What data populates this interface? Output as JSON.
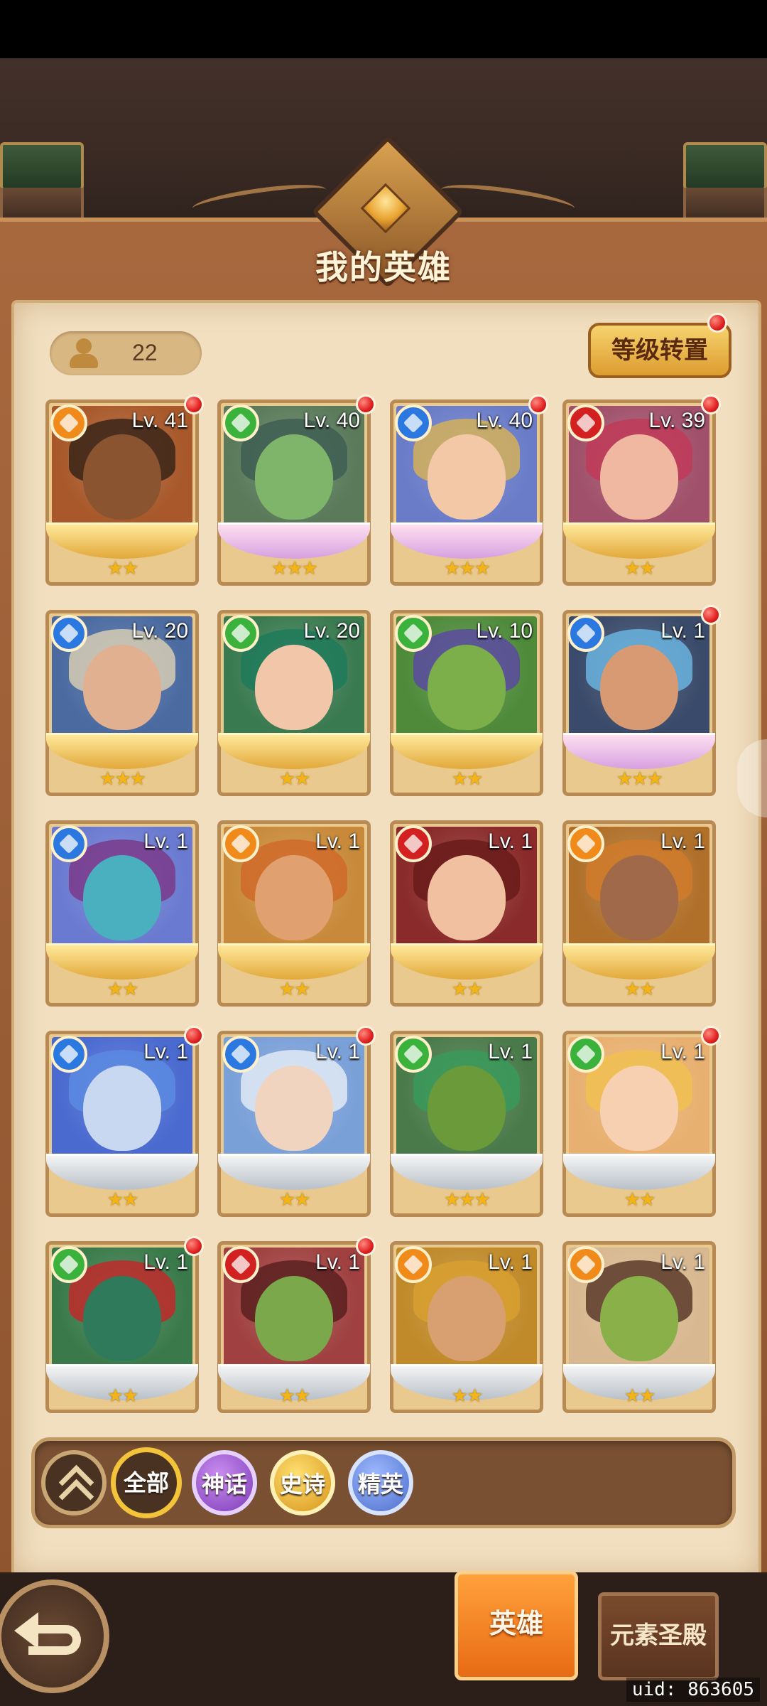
{
  "header": {
    "title": "我的英雄"
  },
  "hero_count": "22",
  "level_transfer_label": "等级转置",
  "colors": {
    "gold": "#e1a83a",
    "element_fire": "#f08a1a",
    "element_wind": "#3bb23b",
    "element_water": "#2a78e0",
    "element_red": "#d32020"
  },
  "heroes": [
    {
      "level": "Lv. 41",
      "stars": "★★",
      "element": "fire",
      "dot": true,
      "band": "gold",
      "bg": "#a8582a",
      "face": "#8a5430",
      "hair": "#3a2418"
    },
    {
      "level": "Lv. 40",
      "stars": "★★★",
      "element": "wind",
      "dot": true,
      "band": "pink",
      "bg": "#5a7a5a",
      "face": "#7fb56a",
      "hair": "#3e5e52"
    },
    {
      "level": "Lv. 40",
      "stars": "★★★",
      "element": "water",
      "dot": true,
      "band": "pink",
      "bg": "#6a7cc8",
      "face": "#f2c8a6",
      "hair": "#d4b05a"
    },
    {
      "level": "Lv. 39",
      "stars": "★★",
      "element": "red",
      "dot": true,
      "band": "gold",
      "bg": "#a0506a",
      "face": "#f0b8a0",
      "hair": "#c03a58"
    },
    {
      "level": "Lv. 20",
      "stars": "★★★",
      "element": "water",
      "dot": false,
      "band": "gold",
      "bg": "#4a6aa0",
      "face": "#e0b090",
      "hair": "#d6ccb4"
    },
    {
      "level": "Lv. 20",
      "stars": "★★",
      "element": "wind",
      "dot": false,
      "band": "gold",
      "bg": "#3a7a50",
      "face": "#f2c6a8",
      "hair": "#1e7a5a"
    },
    {
      "level": "Lv. 10",
      "stars": "★★",
      "element": "wind",
      "dot": false,
      "band": "gold",
      "bg": "#4e8a3a",
      "face": "#7cae4a",
      "hair": "#5a4aa0"
    },
    {
      "level": "Lv. 1",
      "stars": "★★★",
      "element": "water",
      "dot": true,
      "band": "pink",
      "bg": "#3a4a6a",
      "face": "#d89a72",
      "hair": "#6ab4e0"
    },
    {
      "level": "Lv. 1",
      "stars": "★★",
      "element": "water",
      "dot": false,
      "band": "gold",
      "bg": "#6a7ad0",
      "face": "#4ab0c0",
      "hair": "#7a3a8a"
    },
    {
      "level": "Lv. 1",
      "stars": "★★",
      "element": "fire",
      "dot": false,
      "band": "gold",
      "bg": "#c88a3a",
      "face": "#e0a070",
      "hair": "#d06a2a"
    },
    {
      "level": "Lv. 1",
      "stars": "★★",
      "element": "red",
      "dot": false,
      "band": "gold",
      "bg": "#8a2a2a",
      "face": "#f0c0a0",
      "hair": "#6a1a1a"
    },
    {
      "level": "Lv. 1",
      "stars": "★★",
      "element": "fire",
      "dot": false,
      "band": "gold",
      "bg": "#b0702a",
      "face": "#a06a4a",
      "hair": "#d07a2a"
    },
    {
      "level": "Lv. 1",
      "stars": "★★",
      "element": "water",
      "dot": true,
      "band": "silver",
      "bg": "#4a6ad0",
      "face": "#c8d8f0",
      "hair": "#5a8ae0"
    },
    {
      "level": "Lv. 1",
      "stars": "★★",
      "element": "water",
      "dot": true,
      "band": "silver",
      "bg": "#7aa0d8",
      "face": "#f0d4c0",
      "hair": "#e0eaf6"
    },
    {
      "level": "Lv. 1",
      "stars": "★★★",
      "element": "wind",
      "dot": false,
      "band": "silver",
      "bg": "#4a7a4a",
      "face": "#6a9a3a",
      "hair": "#3a9a5a"
    },
    {
      "level": "Lv. 1",
      "stars": "★★",
      "element": "wind",
      "dot": true,
      "band": "silver",
      "bg": "#e8b070",
      "face": "#f6d0b0",
      "hair": "#f0c050"
    },
    {
      "level": "Lv. 1",
      "stars": "★★",
      "element": "wind",
      "dot": true,
      "band": "silver",
      "bg": "#3a7a4a",
      "face": "#2e7a5a",
      "hair": "#c02a2a"
    },
    {
      "level": "Lv. 1",
      "stars": "★★",
      "element": "red",
      "dot": true,
      "band": "silver",
      "bg": "#a04040",
      "face": "#7aa84a",
      "hair": "#5a2020"
    },
    {
      "level": "Lv. 1",
      "stars": "★★",
      "element": "fire",
      "dot": false,
      "band": "silver",
      "bg": "#c08a2a",
      "face": "#d8a070",
      "hair": "#d8a030"
    },
    {
      "level": "Lv. 1",
      "stars": "★★",
      "element": "fire",
      "dot": false,
      "band": "silver",
      "bg": "#d8b890",
      "face": "#8ab04a",
      "hair": "#5a3a2a"
    }
  ],
  "filters": {
    "all": "全部",
    "myth": "神话",
    "epic": "史诗",
    "elite": "精英"
  },
  "tabs": {
    "hero": "英雄",
    "element_temple": "元素圣殿"
  },
  "uid_text": "uid: 863605"
}
